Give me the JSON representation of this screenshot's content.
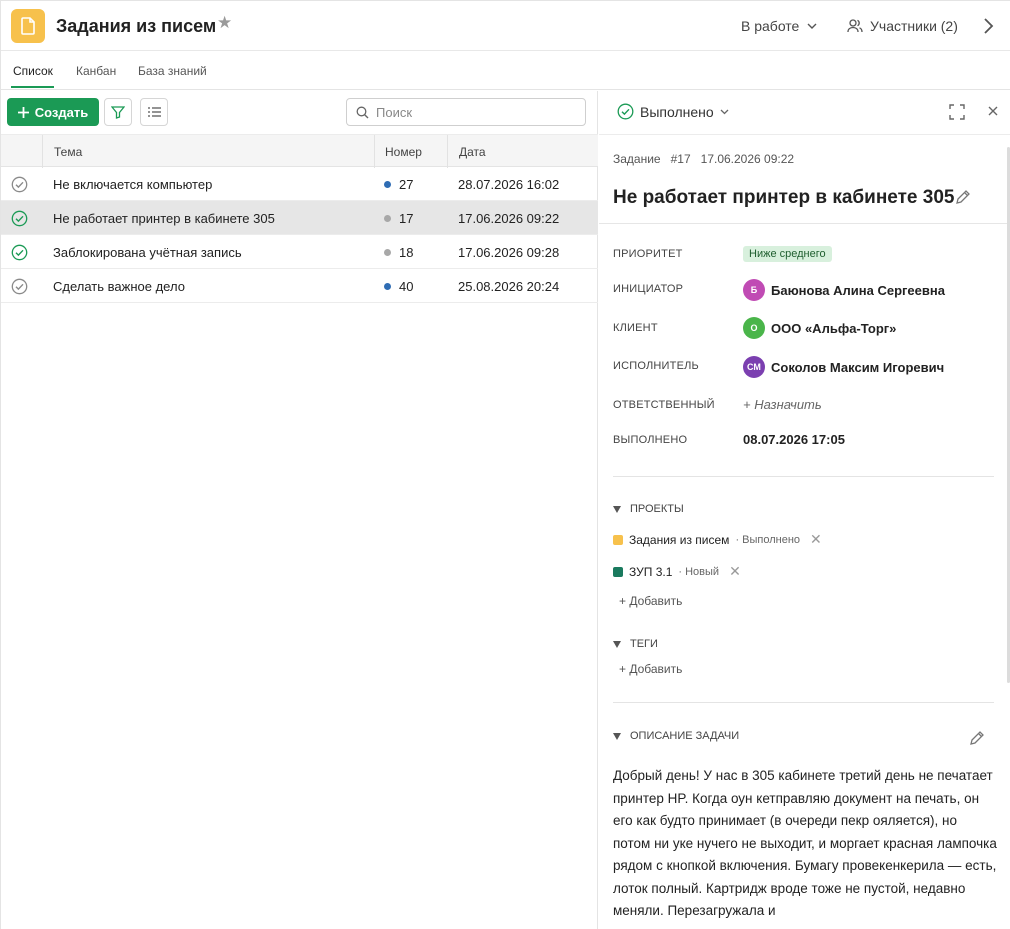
{
  "header": {
    "title": "Задания из писем",
    "status_dropdown": "В работе",
    "participants": "Участники (2)"
  },
  "tabs": [
    "Список",
    "Канбан",
    "База знаний"
  ],
  "toolbar": {
    "create_label": "Создать",
    "search_placeholder": "Поиск"
  },
  "table": {
    "columns": [
      "Тема",
      "Номер",
      "Дата"
    ],
    "rows": [
      {
        "subject": "Не включается компьютер",
        "number": "27",
        "date": "28.07.2026 16:02",
        "done": false,
        "dot_color": "#2f6db4",
        "selected": false
      },
      {
        "subject": "Не работает принтер в кабинете 305",
        "number": "17",
        "date": "17.06.2026 09:22",
        "done": true,
        "dot_color": "#a8a8a8",
        "selected": true
      },
      {
        "subject": "Заблокирована учётная запись",
        "number": "18",
        "date": "17.06.2026 09:28",
        "done": true,
        "dot_color": "#a8a8a8",
        "selected": false
      },
      {
        "subject": "Сделать важное дело",
        "number": "40",
        "date": "25.08.2026 20:24",
        "done": false,
        "dot_color": "#2f6db4",
        "selected": false
      }
    ]
  },
  "detail": {
    "status": "Выполнено",
    "meta_type": "Задание",
    "meta_number": "#17",
    "meta_date": "17.06.2026 09:22",
    "title": "Не работает принтер в кабинете 305",
    "fields": {
      "priority_label": "Приоритет",
      "priority_value": "Ниже среднего",
      "initiator_label": "Инициатор",
      "initiator_initials": "Б",
      "initiator_name": "Баюнова Алина Сергеевна",
      "client_label": "Клиент",
      "client_initials": "О",
      "client_name": "ООО «Альфа-Торг»",
      "executor_label": "Исполнитель",
      "executor_initials": "СМ",
      "executor_name": "Соколов Максим Игоревич",
      "responsible_label": "Ответственный",
      "responsible_value": "+ Назначить",
      "completed_label": "Выполнено",
      "completed_value": "08.07.2026 17:05"
    },
    "projects_header": "Проекты",
    "projects": [
      {
        "name": "Задания из писем",
        "status": "· Выполнено",
        "color": "#f7c14c"
      },
      {
        "name": "ЗУП 3.1",
        "status": "· Новый",
        "color": "#1a7a5e"
      }
    ],
    "projects_add": "+ Добавить",
    "tags_header": "Теги",
    "tags_add": "+ Добавить",
    "description_header": "Описание задачи",
    "description": "Добрый день! У нас в 305 кабинете третий день не печатает принтер HP. Когда оун кетправляю документ на печать, он его как будто принимает (в очереди пекр ояляется), но потом ни уке нучего не выходит, и моргает красная лампочка рядом с кнопкой включения. Бумагу провекенкерила — есть, лоток полный. Картридж вроде тоже не пустой, недавно меняли. Перезагружала и"
  },
  "colors": {
    "accent": "#1b9a55",
    "app_icon": "#f7c14c",
    "avatar_initiator": "#c04bb4",
    "avatar_client": "#4ab54a",
    "avatar_executor": "#7b3fb0"
  }
}
